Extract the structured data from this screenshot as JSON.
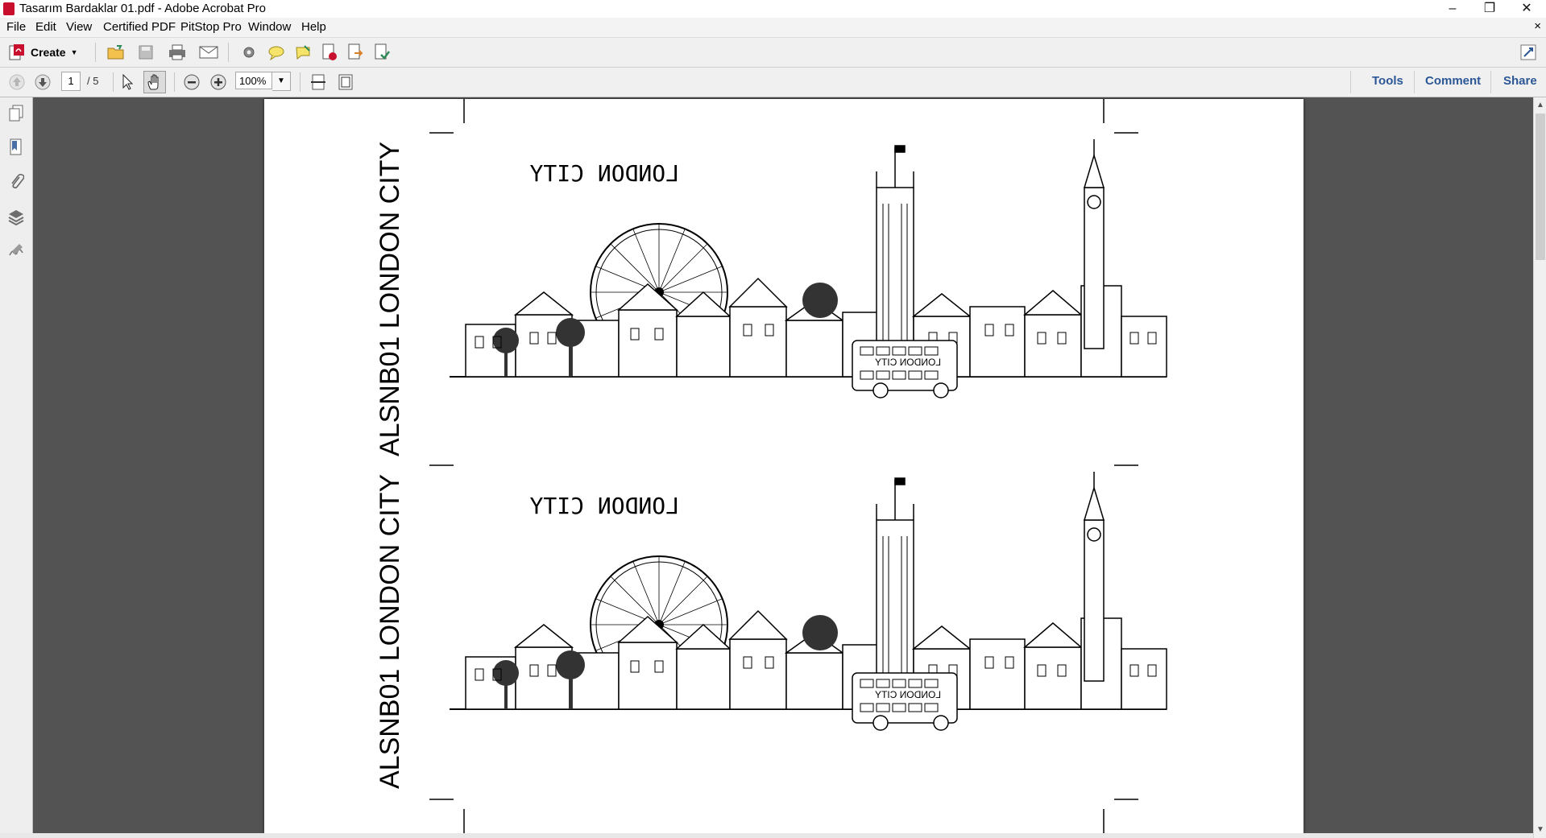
{
  "window": {
    "title": "Tasarım Bardaklar 01.pdf - Adobe Acrobat Pro",
    "minimize": "–",
    "maximize": "❐",
    "close": "✕"
  },
  "menu": {
    "items": [
      "File",
      "Edit",
      "View",
      "Certified PDF",
      "PitStop Pro",
      "Window",
      "Help"
    ],
    "doc_close": "×"
  },
  "toolbar": {
    "create_label": "Create",
    "icons": [
      "open-icon",
      "save-icon",
      "print-icon",
      "email-icon",
      "settings-icon",
      "comment-bubble-icon",
      "sticky-note-icon",
      "pdf-review-icon",
      "export-icon",
      "share-review-icon"
    ]
  },
  "nav": {
    "page_current": "1",
    "page_total": "/ 5",
    "zoom": "100%"
  },
  "panels": {
    "tools": "Tools",
    "comment": "Comment",
    "share": "Share"
  },
  "document": {
    "side_label": "ALSNB01 LONDON CITY",
    "mirrored_caption": "LONDON CITY",
    "bus_sign": "LONDON CITY"
  }
}
